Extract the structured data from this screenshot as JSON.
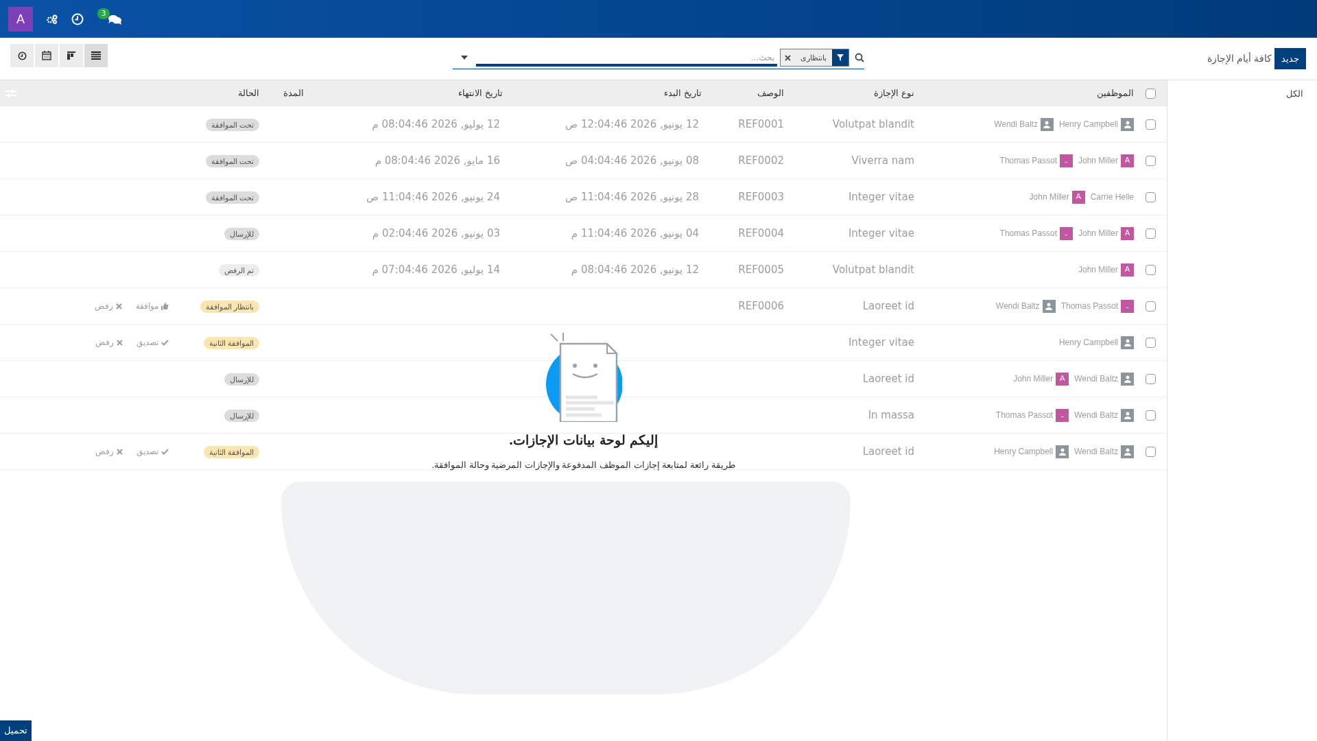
{
  "navbar": {
    "avatar": "A",
    "messages_count": "3"
  },
  "control_panel": {
    "breadcrumb": "كافة أيام الإجازة",
    "new_button": "جديد",
    "search": {
      "placeholder": "بحث...",
      "facets": [
        {
          "label": "بانتظارى"
        }
      ]
    }
  },
  "sidebar": {
    "items": [
      {
        "label": "الكل"
      }
    ]
  },
  "table": {
    "select_all_checked": false,
    "columns": [
      "الموظفين",
      "نوع الإجازة",
      "الوصف",
      "تاريخ البدء",
      "تاريخ الانتهاء",
      "المدة",
      "الحالة"
    ],
    "rows": [
      {
        "employees": [
          {
            "name": "Henry Campbell",
            "kind": "photo"
          },
          {
            "name": "Wendi Baltz",
            "kind": "photo"
          }
        ],
        "leave_type": "Volutpat blandit",
        "description": "REF0001",
        "start": "12 يونيو, 2026 12:04:46 ص",
        "end": "12 يوليو, 2026 08:04:46 م",
        "status": "تحت الموافقة",
        "color": "#dcdcdc",
        "checked": false,
        "actions": []
      },
      {
        "employees": [
          {
            "name": "John Miller",
            "kind": "letter",
            "letter": "A"
          },
          {
            "name": "Thomas Passot",
            "kind": "letter",
            "letter": "ـ"
          }
        ],
        "leave_type": "Viverra nam",
        "description": "REF0002",
        "start": "08 يونيو, 2026 04:04:46 ص",
        "end": "16 مايو, 2026 08:04:46 م",
        "status": "تحت الموافقة",
        "color": "#dcdcdc",
        "checked": false,
        "actions": []
      },
      {
        "employees": [
          {
            "name": "Carrie Helle",
            "kind": "none"
          },
          {
            "name": "John Miller",
            "kind": "letter",
            "letter": "A"
          }
        ],
        "leave_type": "Integer vitae",
        "description": "REF0003",
        "start": "28 يونيو, 2026 11:04:46 ص",
        "end": "24 يونيو, 2026 11:04:46 ص",
        "status": "تحت الموافقة",
        "color": "#dcdcdc",
        "checked": false,
        "actions": []
      },
      {
        "employees": [
          {
            "name": "John Miller",
            "kind": "letter",
            "letter": "A"
          },
          {
            "name": "Thomas Passot",
            "kind": "letter",
            "letter": "ـ"
          }
        ],
        "leave_type": "Integer vitae",
        "description": "REF0004",
        "start": "04 يونيو, 2026 11:04:46 م",
        "end": "03 يونيو, 2026 02:04:46 م",
        "status": "للإرسال",
        "color": "#dcdcdc",
        "checked": false,
        "actions": []
      },
      {
        "employees": [
          {
            "name": "John Miller",
            "kind": "letter",
            "letter": "A"
          }
        ],
        "leave_type": "Volutpat blandit",
        "description": "REF0005",
        "start": "12 يونيو, 2026 08:04:46 م",
        "end": "14 يوليو, 2026 07:04:46 م",
        "status": "تم الرفض",
        "color": "#ececec",
        "checked": false,
        "actions": []
      },
      {
        "employees": [
          {
            "name": "Thomas Passot",
            "kind": "letter",
            "letter": "ـ"
          },
          {
            "name": "Wendi Baltz",
            "kind": "photo"
          }
        ],
        "leave_type": "Laoreet id",
        "description": "REF0006",
        "status": "بانتظار الموافقة",
        "color": "#fbe6b0",
        "checked": false,
        "actions": [
          {
            "kind": "approve",
            "label": "موافقة"
          },
          {
            "kind": "refuse",
            "label": "رفض"
          }
        ]
      },
      {
        "employees": [
          {
            "name": "Henry Campbell",
            "kind": "photo"
          }
        ],
        "leave_type": "Integer vitae",
        "status": "الموافقة الثانية",
        "color": "#fbe6b0",
        "checked": false,
        "actions": [
          {
            "kind": "validate",
            "label": "تصديق"
          },
          {
            "kind": "refuse",
            "label": "رفض"
          }
        ]
      },
      {
        "employees": [
          {
            "name": "Wendi Baltz",
            "kind": "photo"
          },
          {
            "name": "John Miller",
            "kind": "letter",
            "letter": "A"
          }
        ],
        "leave_type": "Laoreet id",
        "status": "للإرسال",
        "color": "#dcdcdc",
        "checked": false,
        "actions": []
      },
      {
        "employees": [
          {
            "name": "Wendi Baltz",
            "kind": "photo"
          },
          {
            "name": "Thomas Passot",
            "kind": "letter",
            "letter": "ـ"
          }
        ],
        "leave_type": "In massa",
        "status": "للإرسال",
        "color": "#dcdcdc",
        "checked": false,
        "actions": []
      },
      {
        "employees": [
          {
            "name": "Wendi Baltz",
            "kind": "photo"
          },
          {
            "name": "Henry Campbell",
            "kind": "photo"
          }
        ],
        "leave_type": "Laoreet id",
        "status": "الموافقة الثانية",
        "color": "#fbe6b0",
        "checked": false,
        "actions": [
          {
            "kind": "validate",
            "label": "تصديق"
          },
          {
            "kind": "refuse",
            "label": "رفض"
          }
        ]
      }
    ]
  },
  "helper": {
    "title": "إليكم لوحة بيانات الإجازات.",
    "text": "طريقة رائعة لمتابعة إجازات الموظف المدفوعة والإجازات المرضية وحالة الموافقة."
  },
  "download_button": "تحميل"
}
